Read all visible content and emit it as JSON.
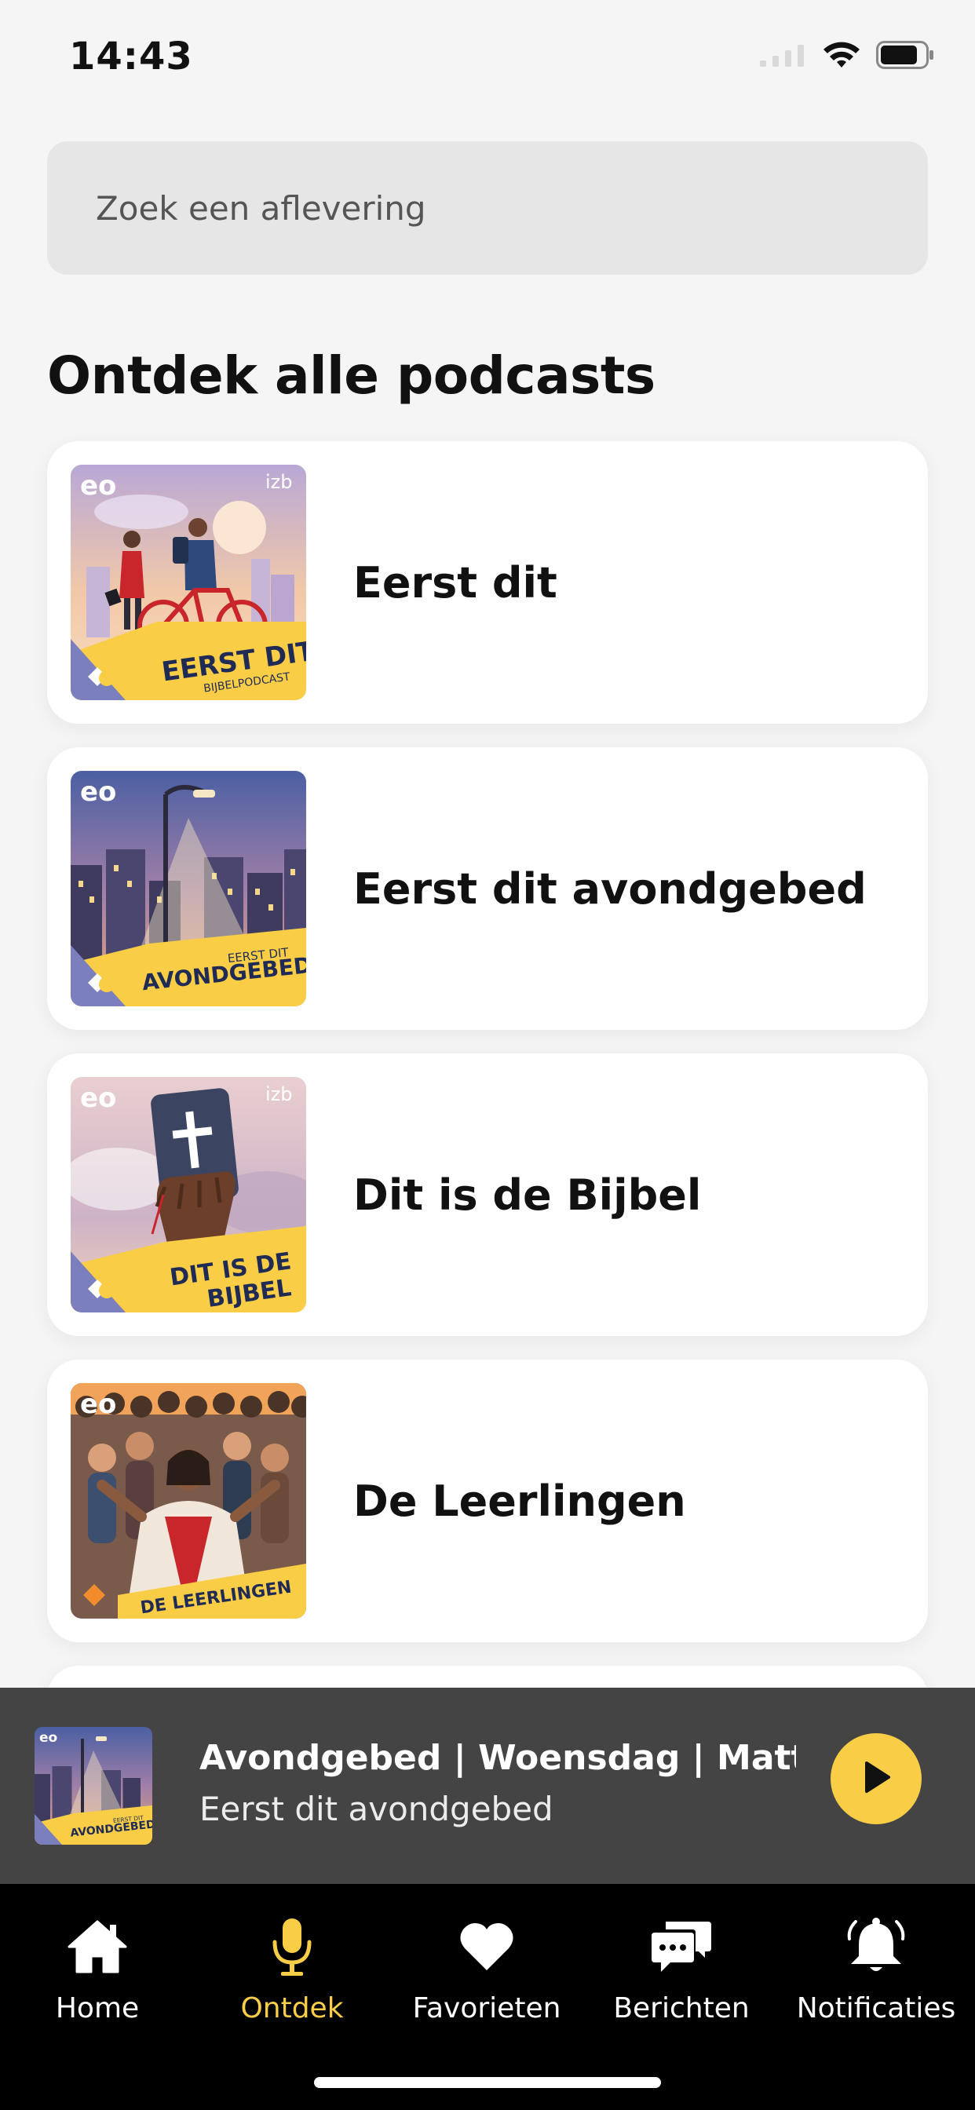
{
  "status_bar": {
    "time": "14:43",
    "icons": [
      "signal-icon",
      "wifi-icon",
      "battery-icon"
    ]
  },
  "search": {
    "placeholder": "Zoek een aflevering"
  },
  "section": {
    "title": "Ontdek alle podcasts"
  },
  "podcasts": [
    {
      "name": "Eerst dit",
      "cover": {
        "logo": "eo",
        "partner_logo": "izb",
        "title": "EERST DIT",
        "subtitle": "BIJBELPODCAST"
      }
    },
    {
      "name": "Eerst dit avondgebed",
      "cover": {
        "logo": "eo",
        "title": "AVONDGEBED",
        "subtitle": "EERST DIT"
      }
    },
    {
      "name": "Dit is de Bijbel",
      "cover": {
        "logo": "eo",
        "partner_logo": "izb",
        "title": "DIT IS DE",
        "title_line2": "BIJBEL"
      }
    },
    {
      "name": "De Leerlingen",
      "cover": {
        "logo": "eo",
        "title": "DE LEERLINGEN"
      }
    }
  ],
  "mini_player": {
    "title": "Avondgebed | Woensdag | Matte...",
    "subtitle": "Eerst dit avondgebed",
    "play_icon": "play-icon"
  },
  "tabs": [
    {
      "label": "Home",
      "icon": "home-icon",
      "active": false
    },
    {
      "label": "Ontdek",
      "icon": "microphone-icon",
      "active": true
    },
    {
      "label": "Favorieten",
      "icon": "heart-icon",
      "active": false
    },
    {
      "label": "Berichten",
      "icon": "chat-bubbles-icon",
      "active": false
    },
    {
      "label": "Notificaties",
      "icon": "bell-icon",
      "active": false
    }
  ],
  "colors": {
    "accent": "#f9ce46",
    "background": "#f5f5f5",
    "card": "#ffffff",
    "mini_player": "#444444",
    "tab_bar": "#000000"
  }
}
